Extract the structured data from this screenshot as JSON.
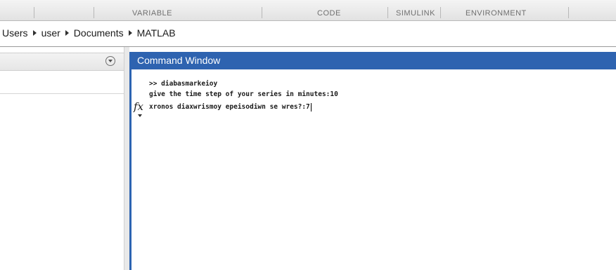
{
  "ribbon": {
    "tabs": [
      "VARIABLE",
      "CODE",
      "SIMULINK",
      "ENVIRONMENT"
    ]
  },
  "address_bar": {
    "crumbs": [
      "Users",
      "user",
      "Documents",
      "MATLAB"
    ]
  },
  "command_window": {
    "title": "Command Window",
    "fx_label": "fx",
    "lines": [
      ">> diabasmarkeioy",
      "give the time step of your series in minutes:10",
      "xronos diaxwrismoy epeisodiwn se wres?:7"
    ]
  },
  "colors": {
    "title_bar": "#2e63b0",
    "ribbon_text": "#707070"
  }
}
